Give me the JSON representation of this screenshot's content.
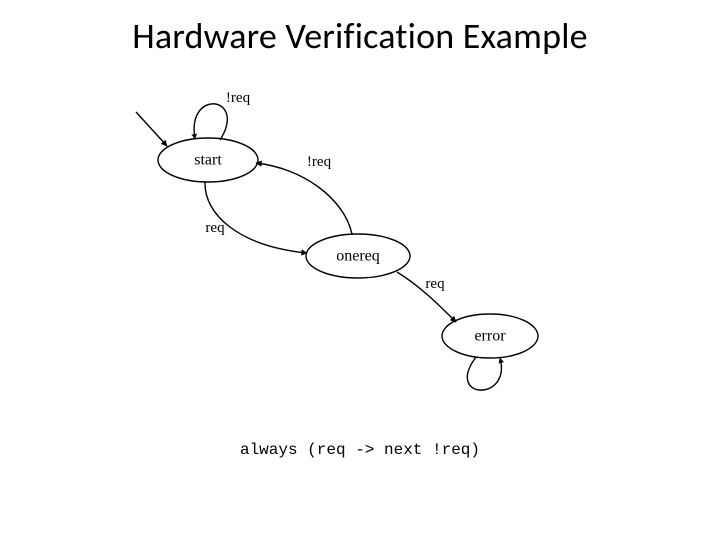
{
  "title": "Hardware Verification Example",
  "nodes": {
    "start": {
      "label": "start"
    },
    "onereq": {
      "label": "onereq"
    },
    "error": {
      "label": "error"
    }
  },
  "edges": {
    "start_self": {
      "label": "!req"
    },
    "start_to_req": {
      "label": "req"
    },
    "onereq_to_start": {
      "label": "!req"
    },
    "onereq_to_error": {
      "label": "req"
    },
    "error_self": {
      "label": ""
    }
  },
  "formula": "always (req -> next !req)"
}
